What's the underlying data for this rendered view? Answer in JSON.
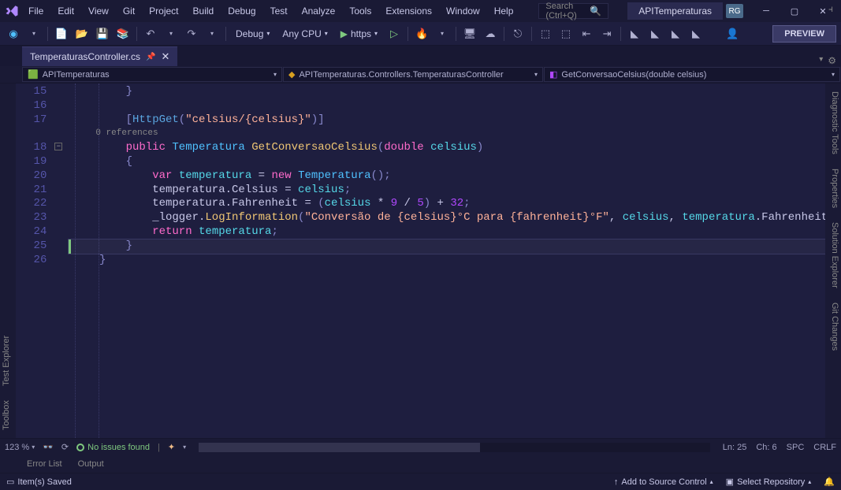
{
  "menu": [
    "File",
    "Edit",
    "View",
    "Git",
    "Project",
    "Build",
    "Debug",
    "Test",
    "Analyze",
    "Tools",
    "Extensions",
    "Window",
    "Help"
  ],
  "search": {
    "placeholder": "Search (Ctrl+Q)"
  },
  "projectName": "APITemperaturas",
  "userInitials": "RG",
  "toolbar": {
    "config": "Debug",
    "platform": "Any CPU",
    "launch": "https"
  },
  "previewLabel": "PREVIEW",
  "sideLeft": [
    "Toolbox",
    "Test Explorer"
  ],
  "sideRight": [
    "Diagnostic Tools",
    "Properties",
    "Solution Explorer",
    "Git Changes"
  ],
  "tab": {
    "name": "TemperaturasController.cs"
  },
  "nav": {
    "project": "APITemperaturas",
    "class": "APITemperaturas.Controllers.TemperaturasController",
    "member": "GetConversaoCelsius(double celsius)"
  },
  "lineNumbers": [
    15,
    16,
    17,
    18,
    19,
    20,
    21,
    22,
    23,
    24,
    25,
    26
  ],
  "code": {
    "l15": "        }",
    "l17_attr": "HttpGet",
    "l17_str": "\"celsius/{celsius}\"",
    "refCount": "0 references",
    "l18_public": "public",
    "l18_type": "Temperatura",
    "l18_method": "GetConversaoCelsius",
    "l18_ptype": "double",
    "l18_pname": "celsius",
    "l20_var": "var",
    "l20_name": "temperatura",
    "l20_new": "new",
    "l20_ctor": "Temperatura",
    "l21_lhs_prop": "Celsius",
    "l21_rhs": "celsius",
    "l22_lhs_prop": "Fahrenheit",
    "l22_expr_var": "celsius",
    "l22_n9": "9",
    "l22_n5": "5",
    "l22_n32": "32",
    "l23_logger": "_logger",
    "l23_method": "LogInformation",
    "l23_str": "\"Conversão de {celsius}°C para {fahrenheit}°F\"",
    "l23_a1": "celsius",
    "l23_a2": "temperatura",
    "l23_a2p": "Fahrenheit",
    "l24_ret": "return",
    "l24_var": "temperatura"
  },
  "editorStatus": {
    "zoom": "123 %",
    "issues": "No issues found",
    "ln": "Ln: 25",
    "ch": "Ch: 6",
    "spaces": "SPC",
    "lineend": "CRLF"
  },
  "bottomTabs": {
    "errorList": "Error List",
    "output": "Output"
  },
  "statusbar": {
    "saved": "Item(s) Saved",
    "addSrc": "Add to Source Control",
    "selectRepo": "Select Repository"
  }
}
